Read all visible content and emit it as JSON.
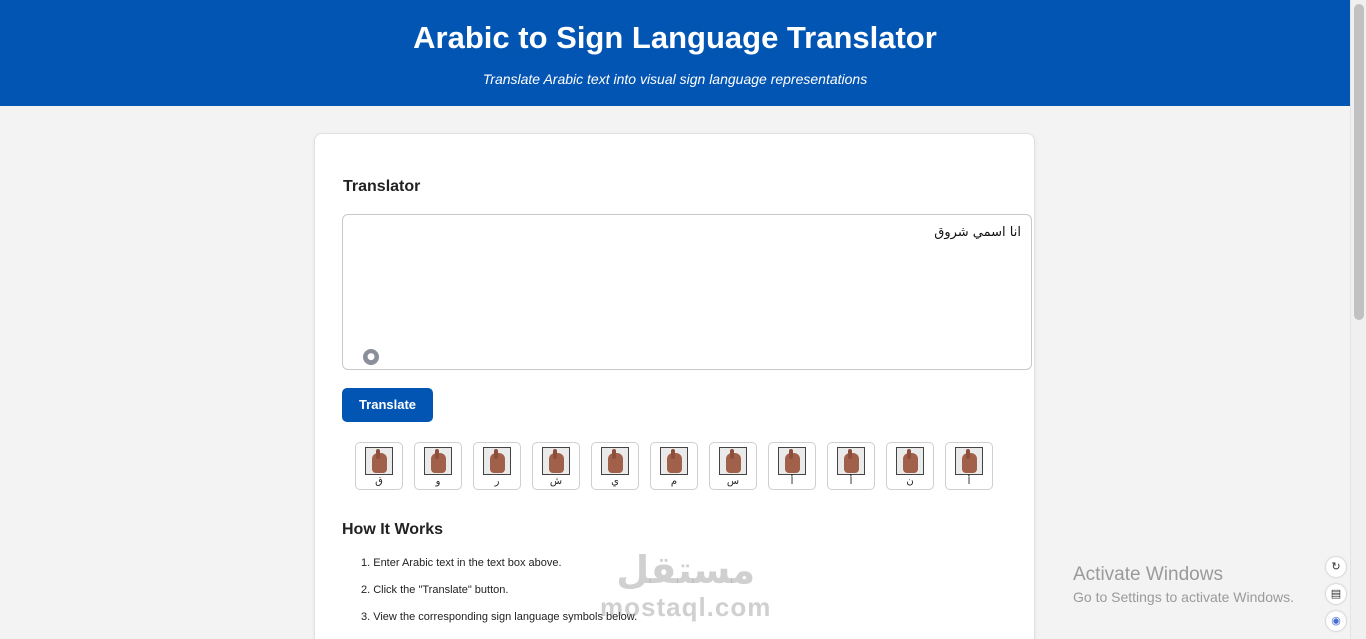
{
  "header": {
    "title": "Arabic to Sign Language Translator",
    "subtitle": "Translate Arabic text into visual sign language representations"
  },
  "translator": {
    "heading": "Translator",
    "input_value": "انا اسمي شروق",
    "translate_label": "Translate"
  },
  "signs": [
    {
      "letter": "ق"
    },
    {
      "letter": "و"
    },
    {
      "letter": "ر"
    },
    {
      "letter": "ش"
    },
    {
      "letter": "ي"
    },
    {
      "letter": "م"
    },
    {
      "letter": "س"
    },
    {
      "letter": "أ"
    },
    {
      "letter": "أ"
    },
    {
      "letter": "ن"
    },
    {
      "letter": "أ"
    }
  ],
  "how": {
    "heading": "How It Works",
    "steps": [
      "1. Enter Arabic text in the text box above.",
      "2. Click the \"Translate\" button.",
      "3. View the corresponding sign language symbols below."
    ]
  },
  "watermark": {
    "arabic": "مستقل",
    "latin": "mostaql.com"
  },
  "activation": {
    "title": "Activate Windows",
    "subtitle": "Go to Settings to activate Windows."
  },
  "icons": {
    "assistant": "assistant-icon",
    "side": [
      "no-translate-icon",
      "reader-icon",
      "brain-icon"
    ]
  }
}
